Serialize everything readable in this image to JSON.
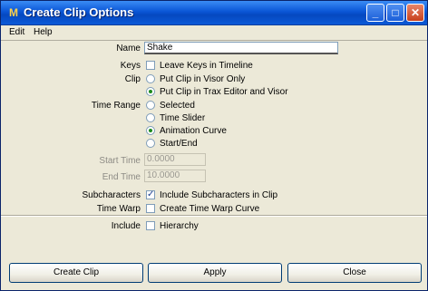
{
  "window": {
    "title": "Create Clip Options",
    "icon": "maya-icon",
    "controls": [
      "minimize-icon",
      "maximize-icon",
      "close-icon"
    ]
  },
  "menubar": {
    "items": [
      "Edit",
      "Help"
    ]
  },
  "form": {
    "name_label": "Name",
    "name_value": "Shake",
    "keys_label": "Keys",
    "keys_option": {
      "label": "Leave Keys in Timeline",
      "checked": false
    },
    "clip_label": "Clip",
    "clip_options": [
      {
        "label": "Put Clip in Visor Only",
        "selected": false
      },
      {
        "label": "Put Clip in Trax Editor and Visor",
        "selected": true
      }
    ],
    "time_range_label": "Time Range",
    "time_range_options": [
      {
        "label": "Selected",
        "selected": false
      },
      {
        "label": "Time Slider",
        "selected": false
      },
      {
        "label": "Animation Curve",
        "selected": true
      },
      {
        "label": "Start/End",
        "selected": false
      }
    ],
    "start_time_label": "Start Time",
    "start_time_value": "0.0000",
    "end_time_label": "End Time",
    "end_time_value": "10.0000",
    "subcharacters_label": "Subcharacters",
    "subcharacters_option": {
      "label": "Include Subcharacters in Clip",
      "checked": true
    },
    "time_warp_label": "Time Warp",
    "time_warp_option": {
      "label": "Create Time Warp Curve",
      "checked": false
    },
    "include_label": "Include",
    "include_option": {
      "label": "Hierarchy",
      "checked": false
    }
  },
  "buttons": {
    "create_clip": "Create Clip",
    "apply": "Apply",
    "close": "Close"
  },
  "colors": {
    "titlebar": "#0a56d6",
    "dialog_bg": "#ece9d8",
    "radio_dot": "#1d8a1d"
  }
}
